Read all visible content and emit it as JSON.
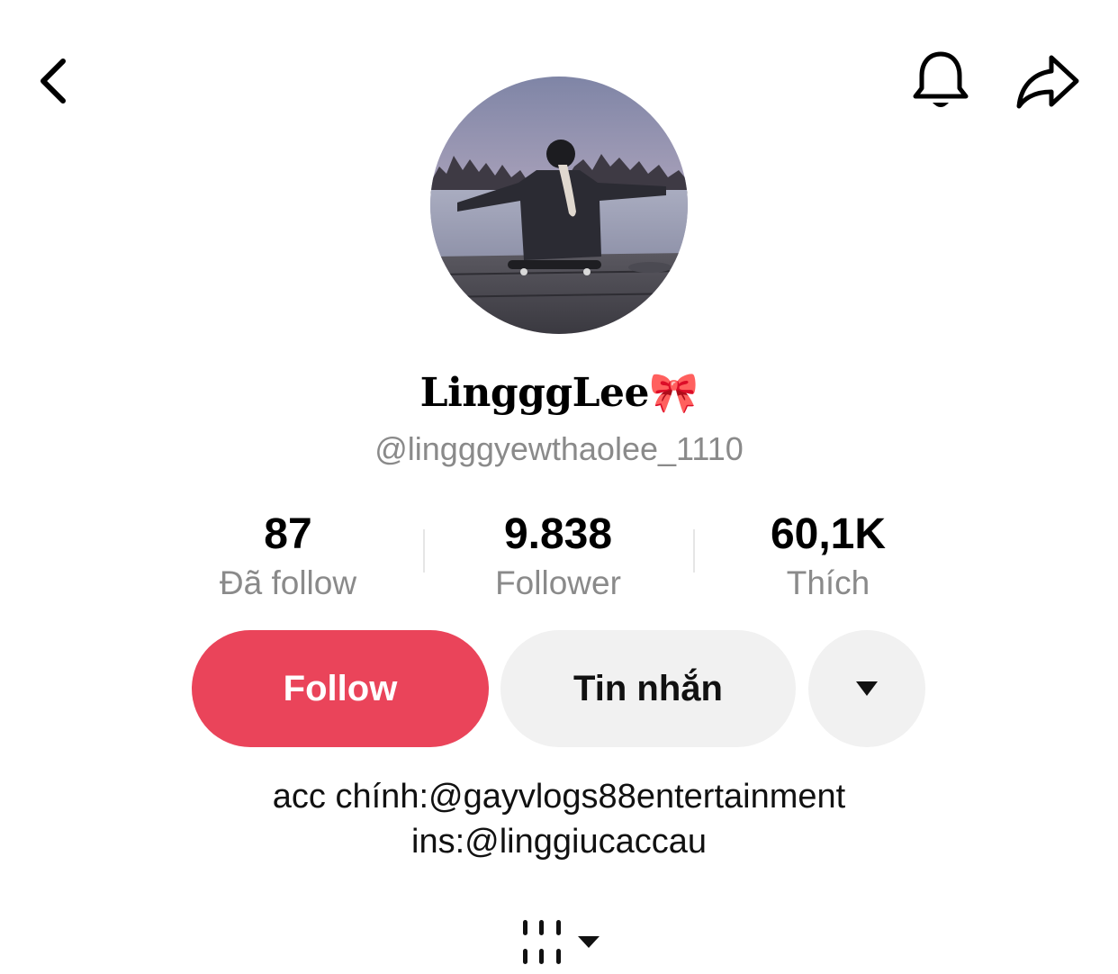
{
  "header": {
    "back_icon": "chevron-left-icon",
    "bell_icon": "bell-icon",
    "share_icon": "share-arrow-icon"
  },
  "profile": {
    "display_name": "LingggLee🎀",
    "username": "@lingggyewthaolee_1110"
  },
  "stats": [
    {
      "value": "87",
      "label": "Đã follow"
    },
    {
      "value": "9.838",
      "label": "Follower"
    },
    {
      "value": "60,1K",
      "label": "Thích"
    }
  ],
  "actions": {
    "follow_label": "Follow",
    "message_label": "Tin nhắn",
    "more_icon": "caret-down-icon"
  },
  "bio": {
    "line1": "acc chính:@gayvlogs88entertainment",
    "line2": "ins:@linggiucaccau"
  },
  "colors": {
    "follow_button": "#ea445a",
    "secondary_button": "#f1f1f1",
    "muted_text": "#8a8a8a"
  }
}
